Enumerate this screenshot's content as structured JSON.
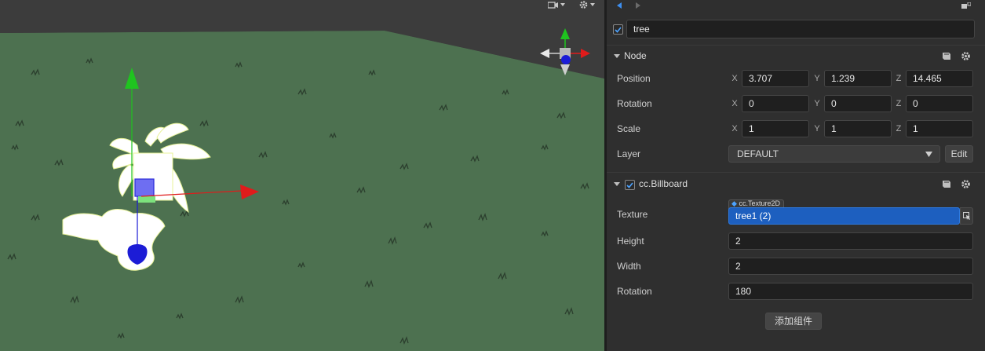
{
  "node": {
    "active": true,
    "name": "tree"
  },
  "node_section": {
    "title": "Node",
    "position": {
      "label": "Position",
      "x_axis": "X",
      "y_axis": "Y",
      "z_axis": "Z",
      "x": "3.707",
      "y": "1.239",
      "z": "14.465"
    },
    "rotation": {
      "label": "Rotation",
      "x_axis": "X",
      "y_axis": "Y",
      "z_axis": "Z",
      "x": "0",
      "y": "0",
      "z": "0"
    },
    "scale": {
      "label": "Scale",
      "x_axis": "X",
      "y_axis": "Y",
      "z_axis": "Z",
      "x": "1",
      "y": "1",
      "z": "1"
    },
    "layer": {
      "label": "Layer",
      "value": "DEFAULT",
      "edit_label": "Edit"
    }
  },
  "billboard": {
    "enabled": true,
    "title": "cc.Billboard",
    "texture": {
      "label": "Texture",
      "type_tag": "cc.Texture2D",
      "value": "tree1 (2)"
    },
    "height": {
      "label": "Height",
      "value": "2"
    },
    "width": {
      "label": "Width",
      "value": "2"
    },
    "rotation": {
      "label": "Rotation",
      "value": "180"
    }
  },
  "add_component_label": "添加组件",
  "colors": {
    "ground": "#4d7150",
    "selection_blue": "#1d5fbf",
    "axis_x": "#e01b1b",
    "axis_y": "#1fc41f",
    "axis_z": "#1c1cd6"
  },
  "icons": [
    "camera-icon",
    "gear-icon",
    "back-arrow-icon",
    "forward-arrow-icon",
    "lock-icon",
    "help-book-icon",
    "component-gear-icon",
    "asset-pick-icon",
    "dropdown-arrow-icon"
  ]
}
